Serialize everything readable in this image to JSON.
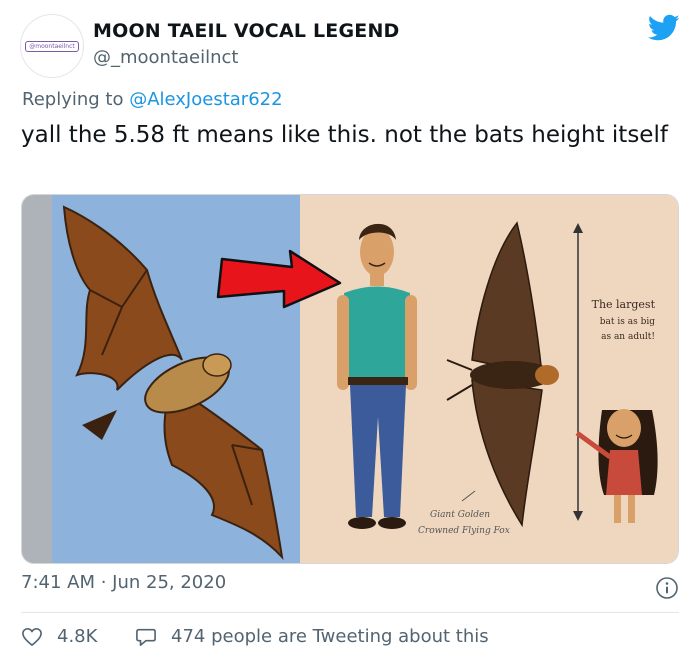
{
  "tweet": {
    "display_name": "MOON TAEIL VOCAL LEGEND",
    "handle": "@_moontaeilnct",
    "avatar_text": "@moontaeilnct",
    "replying_prefix": "Replying to ",
    "replying_to": "@AlexJoestar622",
    "text": "yall the 5.58 ft means like this. not the bats height itself",
    "timestamp": "7:41 AM · Jun 25, 2020",
    "like_count": "4.8K",
    "tweeting_about": "474 people are Tweeting about this"
  },
  "image": {
    "caption_line1": "The largest",
    "caption_line2": "bat is as big",
    "caption_line3": "as an adult!",
    "label_line1": "Giant Golden",
    "label_line2": "Crowned Flying Fox"
  },
  "colors": {
    "twitter_blue": "#1da1f2",
    "link_blue": "#1b95e0",
    "secondary_text": "#536471",
    "arrow_red": "#e8141c",
    "sky_blue": "#8db3dc",
    "parchment": "#efd7bf"
  },
  "icons": [
    "twitter-bird-icon",
    "info-icon",
    "heart-icon",
    "speech-bubble-icon"
  ]
}
